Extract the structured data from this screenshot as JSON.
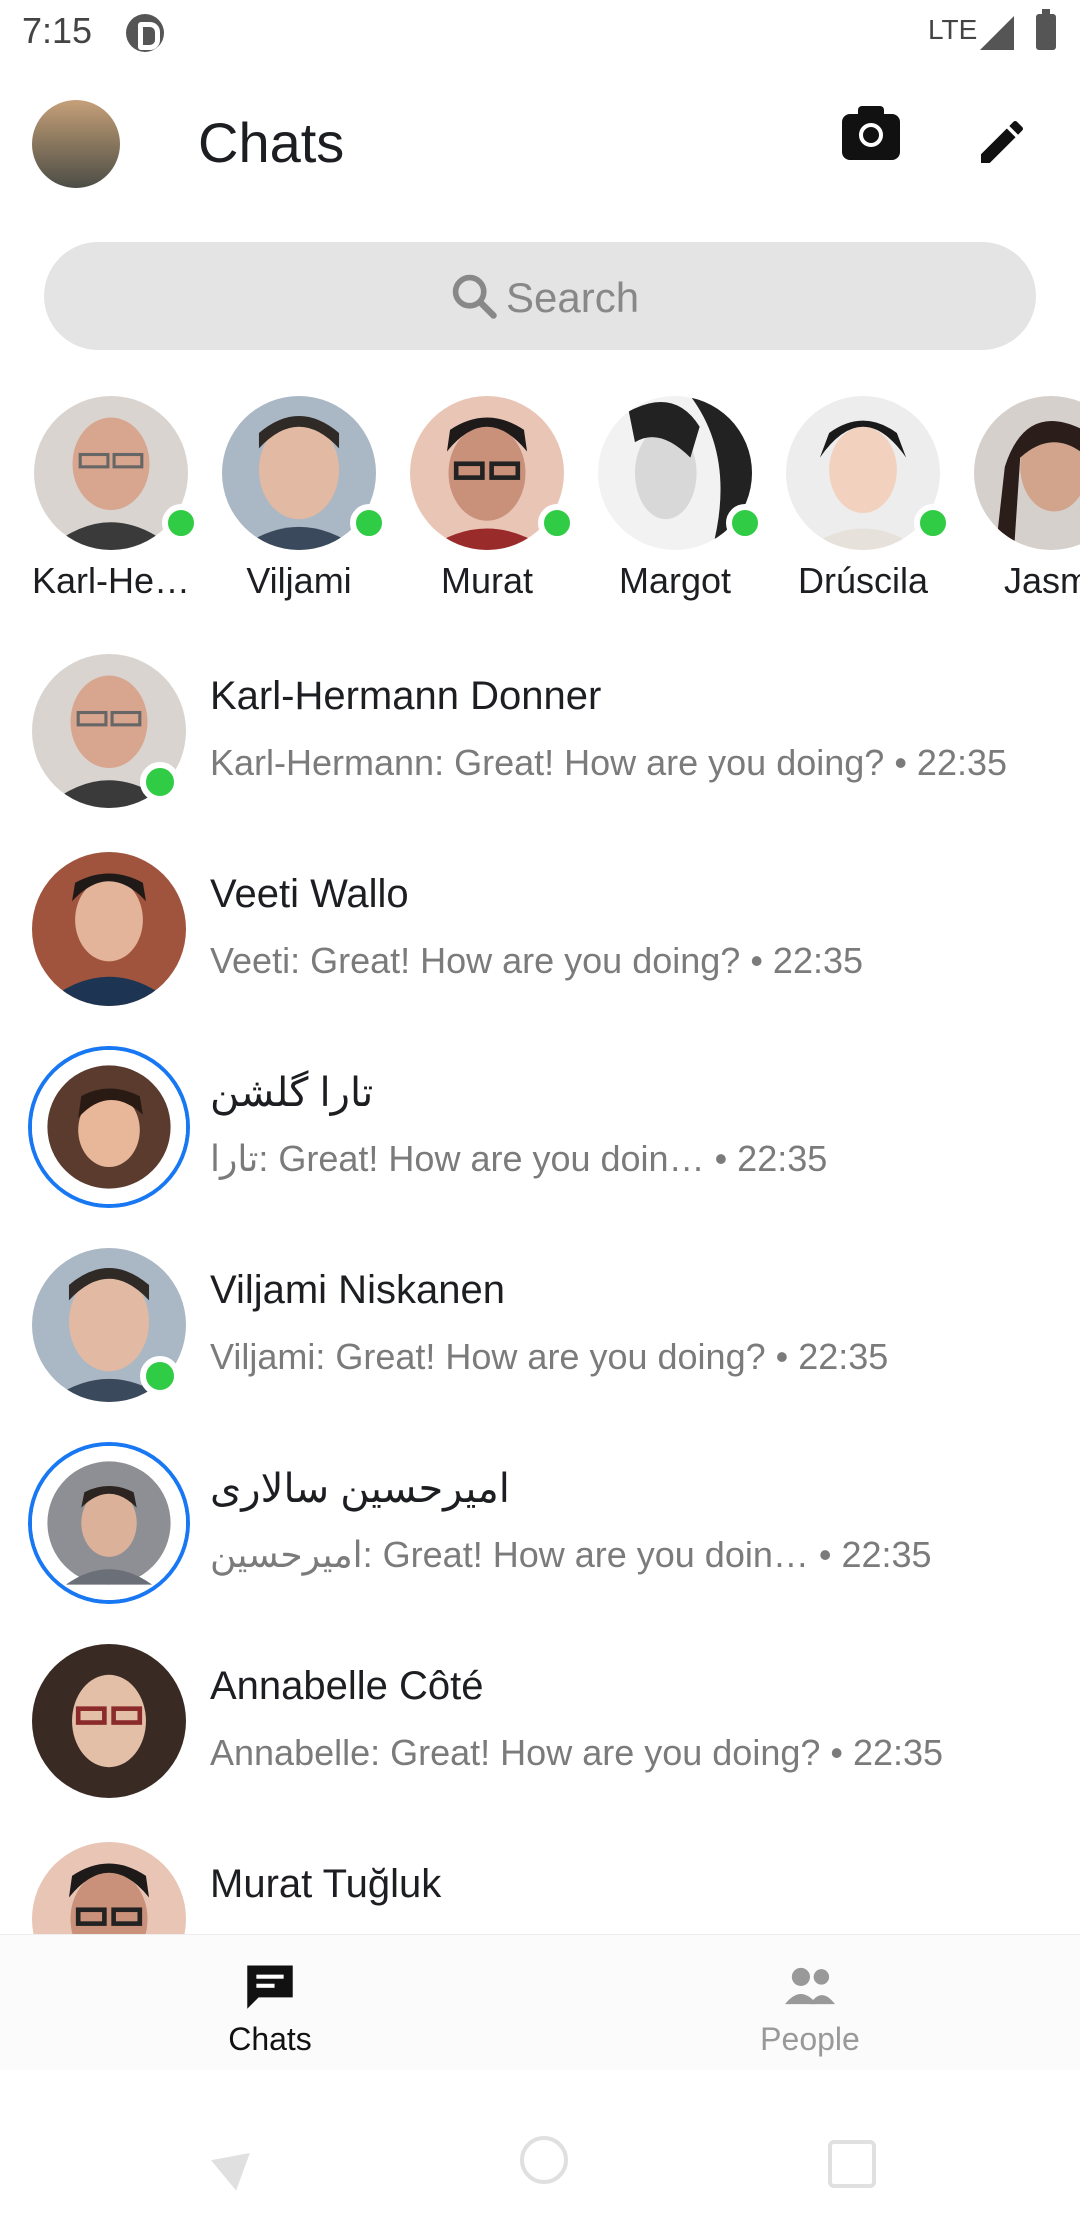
{
  "status_bar": {
    "time": "7:15",
    "network": "LTE"
  },
  "header": {
    "title": "Chats"
  },
  "search": {
    "placeholder": "Search"
  },
  "stories": [
    {
      "name": "Karl-He…",
      "online": true
    },
    {
      "name": "Viljami",
      "online": true
    },
    {
      "name": "Murat",
      "online": true
    },
    {
      "name": "Margot",
      "online": true
    },
    {
      "name": "Drúscila",
      "online": true
    },
    {
      "name": "Jasmi",
      "online": true
    }
  ],
  "chats": [
    {
      "name": "Karl-Hermann Donner",
      "preview": "Karl-Hermann: Great! How are you doing? • 22:35",
      "online": true,
      "story_ring": false
    },
    {
      "name": "Veeti Wallo",
      "preview": "Veeti: Great! How are you doing? • 22:35",
      "online": false,
      "story_ring": false
    },
    {
      "name": "تارا گلشن",
      "preview": "تارا: Great! How are you doin…  • 22:35",
      "online": false,
      "story_ring": true
    },
    {
      "name": "Viljami Niskanen",
      "preview": "Viljami: Great! How are you doing? • 22:35",
      "online": true,
      "story_ring": false
    },
    {
      "name": "امیرحسین سالاری",
      "preview": "امیرحسین: Great! How are you doin…  • 22:35",
      "online": false,
      "story_ring": true
    },
    {
      "name": "Annabelle Côté",
      "preview": "Annabelle: Great! How are you doing? • 22:35",
      "online": false,
      "story_ring": false
    },
    {
      "name": "Murat Tuğluk",
      "preview": "",
      "online": false,
      "story_ring": false
    }
  ],
  "bottom_nav": {
    "chats_label": "Chats",
    "people_label": "People"
  },
  "colors": {
    "accent": "#1877f2",
    "online": "#31cc46",
    "search_bg": "#e4e4e4"
  }
}
